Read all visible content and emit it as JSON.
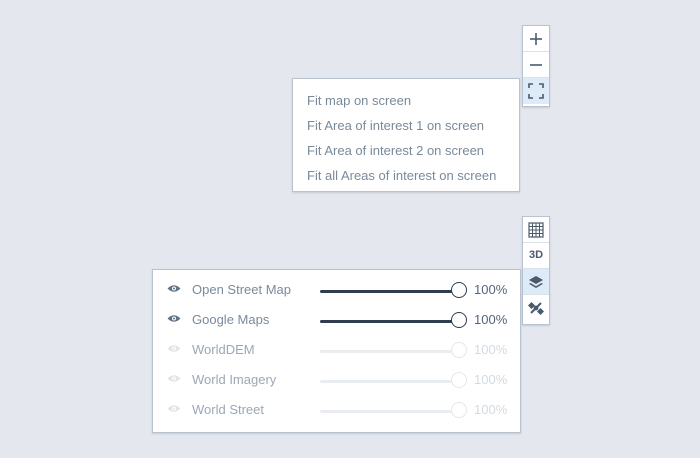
{
  "colors": {
    "background": "#e4e8ee",
    "active_control": "#dcebf7",
    "slider_enabled": "#2e3d4f",
    "slider_disabled": "#e9edf1",
    "text": "#7a8a9a"
  },
  "zoom_controls": {
    "zoom_in_icon": "plus-icon",
    "zoom_out_icon": "minus-icon",
    "fit_icon": "fullscreen-corners-icon",
    "fit_active": true
  },
  "fit_menu": {
    "items": [
      {
        "label": "Fit map on screen"
      },
      {
        "label": "Fit Area of interest 1 on screen"
      },
      {
        "label": "Fit Area of interest 2 on screen"
      },
      {
        "label": "Fit all Areas of interest on screen"
      }
    ]
  },
  "view_controls": {
    "grid_icon": "grid-icon",
    "three_d_label": "3D",
    "layers_icon": "layers-icon",
    "layers_active": true,
    "satellite_icon": "satellite-icon"
  },
  "layers": [
    {
      "name": "Open Street Map",
      "visible": true,
      "opacity": 100,
      "opacity_label": "100%"
    },
    {
      "name": "Google Maps",
      "visible": true,
      "opacity": 100,
      "opacity_label": "100%"
    },
    {
      "name": "WorldDEM",
      "visible": false,
      "opacity": 100,
      "opacity_label": "100%"
    },
    {
      "name": "World Imagery",
      "visible": false,
      "opacity": 100,
      "opacity_label": "100%"
    },
    {
      "name": "World Street",
      "visible": false,
      "opacity": 100,
      "opacity_label": "100%"
    }
  ]
}
